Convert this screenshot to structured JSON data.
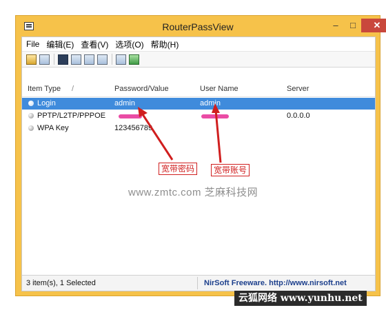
{
  "window": {
    "title": "RouterPassView",
    "controls": {
      "minimize": "–",
      "maximize": "□",
      "close": "✕"
    }
  },
  "menubar": {
    "items": [
      "File",
      "编辑(E)",
      "查看(V)",
      "选项(O)",
      "帮助(H)"
    ]
  },
  "toolbar": {
    "buttons": [
      "open-file-icon",
      "refresh-icon",
      "save-icon",
      "copy-icon",
      "copy-all-icon",
      "properties-icon",
      "find-icon",
      "exit-icon"
    ]
  },
  "list": {
    "columns": [
      "Item Type",
      "Password/Value",
      "User Name",
      "Server"
    ],
    "sort_indicator": "/",
    "rows": [
      {
        "type": "Login",
        "value": "admin",
        "user": "admin",
        "server": ""
      },
      {
        "type": "PPTP/L2TP/PPPOE",
        "value": "",
        "user": "",
        "server": "0.0.0.0"
      },
      {
        "type": "WPA Key",
        "value": "123456789",
        "user": "",
        "server": ""
      }
    ],
    "selected_index": 0
  },
  "annotations": {
    "password_label": "宽带密码",
    "username_label": "宽带账号",
    "color": "#d01e1e"
  },
  "watermark": "www.zmtc.com 芝麻科技网",
  "statusbar": {
    "left": "3 item(s), 1 Selected",
    "right": "NirSoft Freeware.  http://www.nirsoft.net"
  },
  "site_badge": "云狐网络 www.yunhu.net",
  "colors": {
    "frame": "#f6c24a",
    "selection": "#3f8bdc",
    "close_button": "#c9483c",
    "redaction": "#e8399b"
  }
}
